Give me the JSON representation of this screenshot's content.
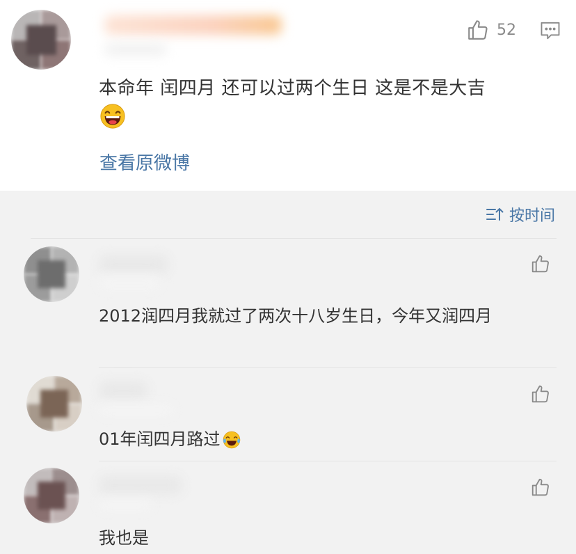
{
  "post": {
    "like_count": "52",
    "text": "本命年 闰四月 还可以过两个生日 这是不是大吉",
    "view_original": "查看原微博"
  },
  "sort": {
    "label": "按时间"
  },
  "replies": [
    {
      "text": "2012润四月我就过了两次十八岁生日，今年又润四月"
    },
    {
      "text": "01年闰四月路过"
    },
    {
      "text": "我也是"
    }
  ],
  "colors": {
    "link": "#4a77a6",
    "text": "#333333",
    "muted": "#8a8a8a",
    "background": "#f2f2f2"
  },
  "icons": [
    "thumbs-up-icon",
    "comment-icon",
    "sort-icon",
    "laughing-emoji",
    "crying-laughing-emoji"
  ]
}
